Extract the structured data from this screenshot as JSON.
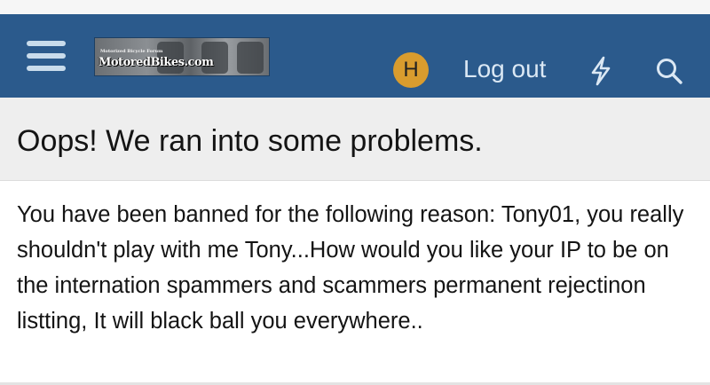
{
  "header": {
    "logo": {
      "tagline": "Motorized Bicycle Forum",
      "brand": "MotoredBikes.com"
    },
    "menu_icon": "hamburger-menu-icon",
    "avatar_initial": "H",
    "logout_label": "Log out",
    "whats_new_icon": "bolt-icon",
    "search_icon": "search-icon",
    "background_color": "#2b5a8c",
    "avatar_color": "#d99c2e"
  },
  "error": {
    "title": "Oops! We ran into some problems.",
    "message": "You have been banned for the following reason: Tony01, you really shouldn't play with me Tony...How would you like your IP to be on the internation spammers and scammers permanent rejectinon listting, It will black ball you everywhere.."
  }
}
